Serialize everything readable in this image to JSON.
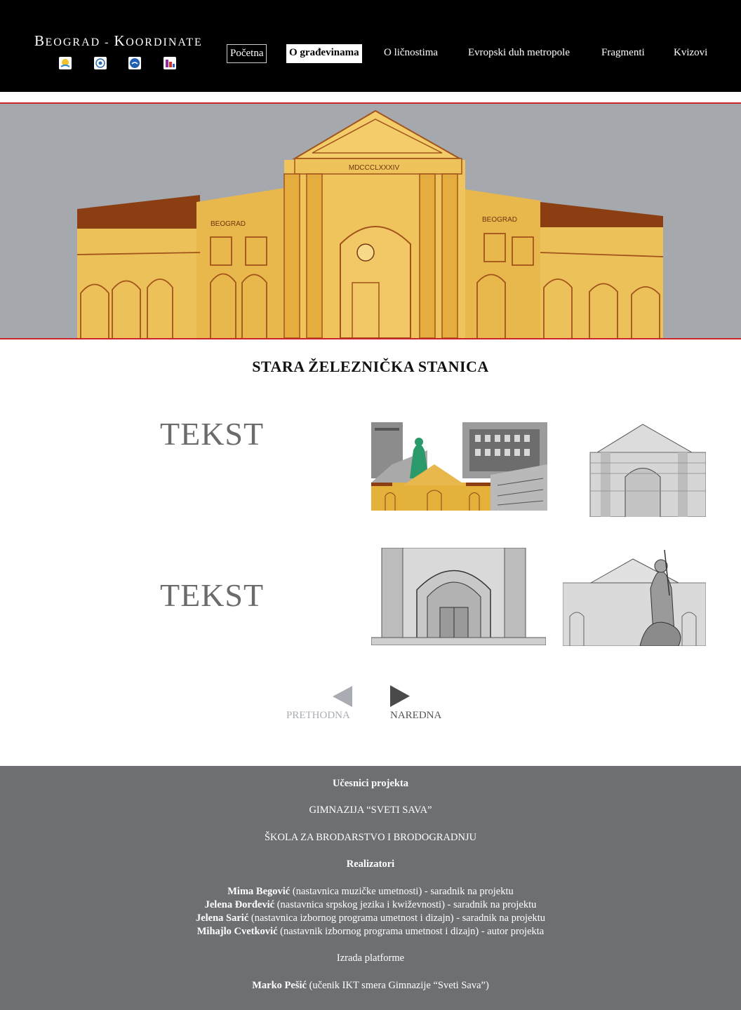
{
  "header": {
    "title_big": "B",
    "title_rest": "EOGRAD - ",
    "title_big2": "K",
    "title_rest2": "OORDINATE",
    "logos": [
      "school-logo-1",
      "school-logo-2",
      "school-logo-3",
      "school-logo-4"
    ]
  },
  "nav": {
    "items": [
      "Početna",
      "O građevinama",
      "O ličnostima",
      "Evropski duh metropole",
      "Fragmenti",
      "Kvizovi"
    ],
    "active": "O građevinama"
  },
  "hero": {
    "sign_left": "BEOGRAD",
    "sign_right": "BEOGRAD",
    "roman": "MDCCCLXXXIV",
    "colors": {
      "background": "#a5a8ad",
      "building": "#e8b547",
      "roof": "#8a3e12",
      "border": "#c8262b"
    }
  },
  "page_title": "STARA ŽELEZNIČKA STANICA",
  "sections": [
    {
      "label": "TEKST"
    },
    {
      "label": "TEKST"
    }
  ],
  "pager": {
    "prev": "PRETHODNA",
    "next": "NAREDNA"
  },
  "footer": {
    "participants_heading": "Učesnici projekta",
    "school1": "GIMNAZIJA “SVETI SAVA”",
    "school2": "ŠKOLA ZA BRODARSTVO I BRODOGRADNJU",
    "realizers_heading": "Realizatori",
    "people": [
      {
        "name": "Mima Begović",
        "role": " (nastavnica muzičke umetnosti) - saradnik na projektu"
      },
      {
        "name": "Jelena Đorđević",
        "role": " (nastavnica srpskog jezika i kwiževnosti) - saradnik na projektu"
      },
      {
        "name": "Jelena Sarić",
        "role": " (nastavnica izbornog programa umetnost i dizajn) - saradnik na projektu"
      },
      {
        "name": "Mihajlo Cvetković",
        "role": " (nastavnik izbornog programa umetnost i dizajn) - autor projekta"
      }
    ],
    "platform_heading": "Izrada platforme",
    "developer_name": "Marko Pešić",
    "developer_role": " (učenik IKT smera Gimnazije “Sveti Sava”)"
  }
}
